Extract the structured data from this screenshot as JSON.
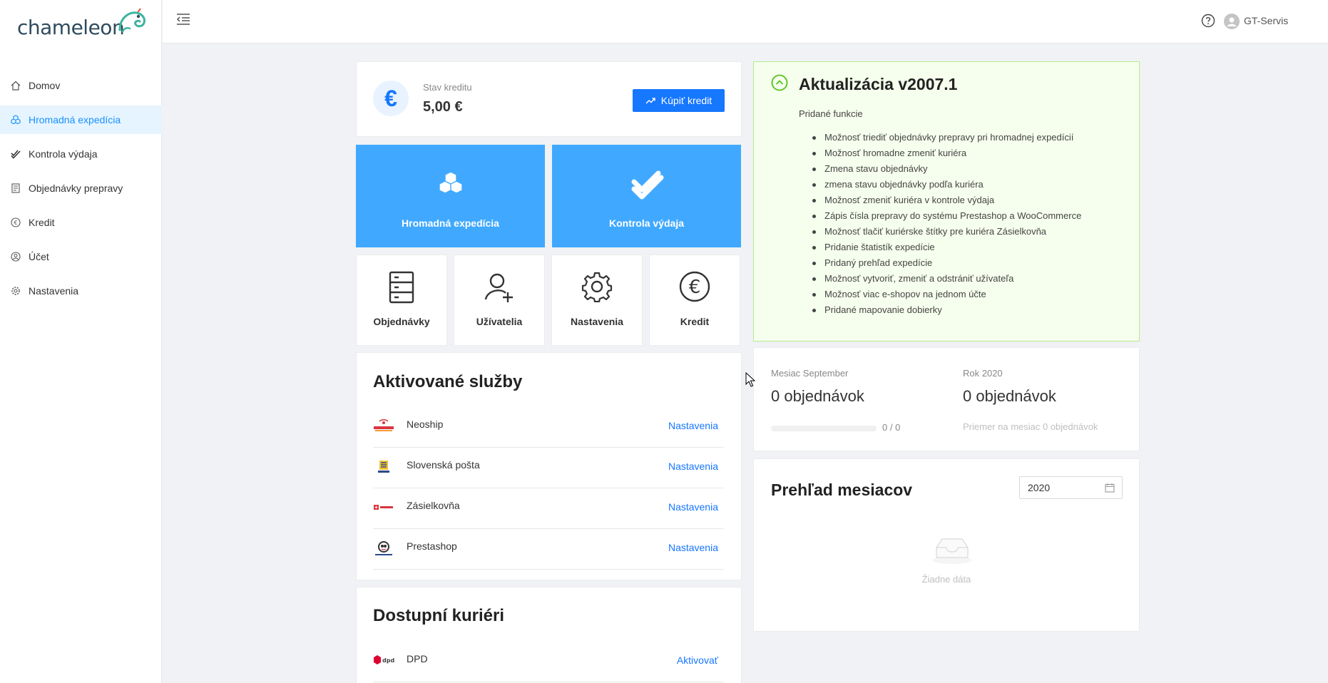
{
  "app": {
    "logo_text": "chameleon",
    "brand_color": "#2f4b5e",
    "accent_color": "#1677ff",
    "tile_color": "#40a9ff"
  },
  "sidebar": {
    "items": [
      {
        "label": "Domov",
        "icon": "home-icon"
      },
      {
        "label": "Hromadná expedícia",
        "icon": "boxes-icon",
        "active": true
      },
      {
        "label": "Kontrola výdaja",
        "icon": "double-check-icon"
      },
      {
        "label": "Objednávky prepravy",
        "icon": "orders-icon"
      },
      {
        "label": "Kredit",
        "icon": "euro-icon"
      },
      {
        "label": "Účet",
        "icon": "user-icon"
      },
      {
        "label": "Nastavenia",
        "icon": "gear-icon"
      }
    ]
  },
  "header": {
    "username": "GT-Servis"
  },
  "credit": {
    "label": "Stav kreditu",
    "value": "5,00 €",
    "buy_label": "Kúpiť kredit"
  },
  "big_tiles": [
    {
      "label": "Hromadná expedícia",
      "icon": "boxes-icon"
    },
    {
      "label": "Kontrola výdaja",
      "icon": "double-check-icon"
    }
  ],
  "small_tiles": [
    {
      "label": "Objednávky",
      "icon": "server-icon"
    },
    {
      "label": "Užívatelia",
      "icon": "user-add-icon"
    },
    {
      "label": "Nastavenia",
      "icon": "gear-icon"
    },
    {
      "label": "Kredit",
      "icon": "euro-icon"
    }
  ],
  "services": {
    "title": "Aktivované služby",
    "rows": [
      {
        "name": "Neoship",
        "link": "Nastavenia"
      },
      {
        "name": "Slovenská pošta",
        "link": "Nastavenia"
      },
      {
        "name": "Zásielkovňa",
        "link": "Nastavenia"
      },
      {
        "name": "Prestashop",
        "link": "Nastavenia"
      }
    ]
  },
  "couriers": {
    "title": "Dostupní kuriéri",
    "rows": [
      {
        "name": "DPD",
        "link": "Aktivovať"
      }
    ]
  },
  "update": {
    "title": "Aktualizácia v2007.1",
    "subtitle": "Pridané funkcie",
    "items": [
      "Možnosť triediť objednávky prepravy pri hromadnej expedícií",
      "Možnosť hromadne zmeniť kuriéra",
      "Zmena stavu objednávky",
      "zmena stavu objednávky podľa kuriéra",
      "Možnosť zmeniť kuriéra v kontrole výdaja",
      "Zápis čísla prepravy do systému Prestashop a WooCommerce",
      "Možnosť tlačiť kuriérske štítky pre kuriéra Zásielkovňa",
      "Pridanie štatistík expedície",
      "Pridaný prehľad expedície",
      "Možnosť vytvoriť, zmeniť a odstrániť užívateľa",
      "Možnosť viac e-shopov na jednom účte",
      "Pridané mapovanie dobierky"
    ]
  },
  "stats": {
    "month_label": "Mesiac September",
    "month_value": "0 objednávok",
    "progress_text": "0 / 0",
    "progress_fraction": 0,
    "year_label": "Rok 2020",
    "year_value": "0 objednávok",
    "year_note": "Priemer na mesiac 0 objednávok"
  },
  "months": {
    "title": "Prehľad mesiacov",
    "year": "2020",
    "empty_text": "Žiadne dáta"
  }
}
